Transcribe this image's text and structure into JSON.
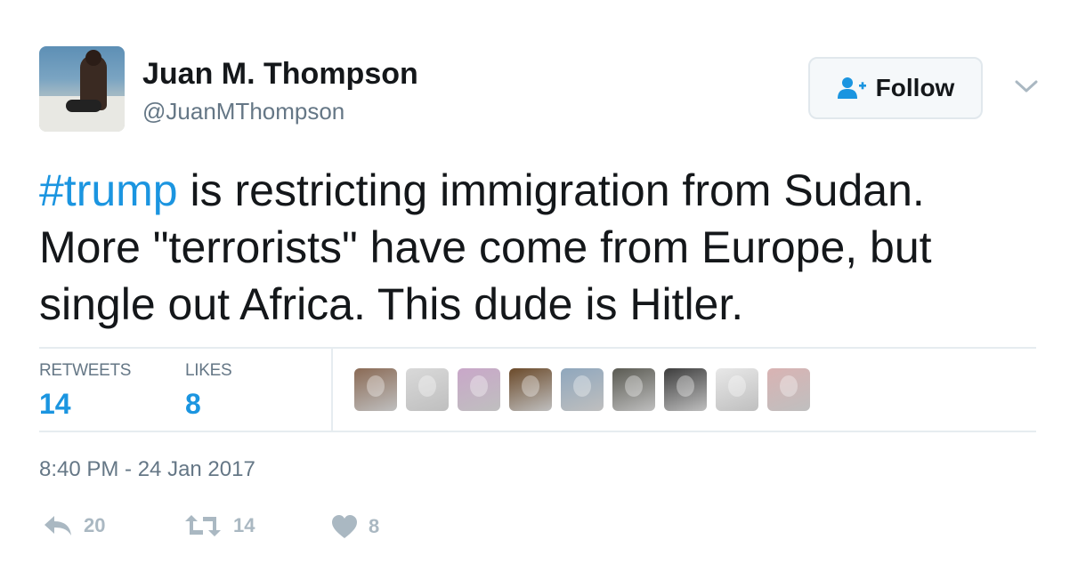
{
  "user": {
    "display_name": "Juan M. Thompson",
    "handle": "@JuanMThompson"
  },
  "follow_button": {
    "label": "Follow",
    "icon": "add-user-icon"
  },
  "tweet": {
    "hashtag": "#trump",
    "text": " is restricting immigration from Sudan. More \"terrorists\" have come from Europe, but single out Africa. This dude is Hitler."
  },
  "stats": {
    "retweets_label": "RETWEETS",
    "retweets_count": "14",
    "likes_label": "LIKES",
    "likes_count": "8"
  },
  "likers": [
    {
      "name": "liker-avatar-1",
      "color": "#8a6a55"
    },
    {
      "name": "liker-avatar-2",
      "color": "#d9d9d9"
    },
    {
      "name": "liker-avatar-3",
      "color": "#c9a7c9"
    },
    {
      "name": "liker-avatar-4",
      "color": "#6b4a2a"
    },
    {
      "name": "liker-avatar-5",
      "color": "#8fa7bd"
    },
    {
      "name": "liker-avatar-6",
      "color": "#5a5a52"
    },
    {
      "name": "liker-avatar-7",
      "color": "#3d3d3d"
    },
    {
      "name": "liker-avatar-8",
      "color": "#e8e8e8"
    },
    {
      "name": "liker-avatar-9",
      "color": "#d9b3b3"
    }
  ],
  "timestamp": "8:40 PM - 24 Jan 2017",
  "actions": {
    "reply_count": "20",
    "retweet_count": "14",
    "like_count": "8"
  },
  "colors": {
    "link": "#1b95e0",
    "muted": "#657786",
    "action": "#aab8c2",
    "divider": "#e6ecf0"
  }
}
